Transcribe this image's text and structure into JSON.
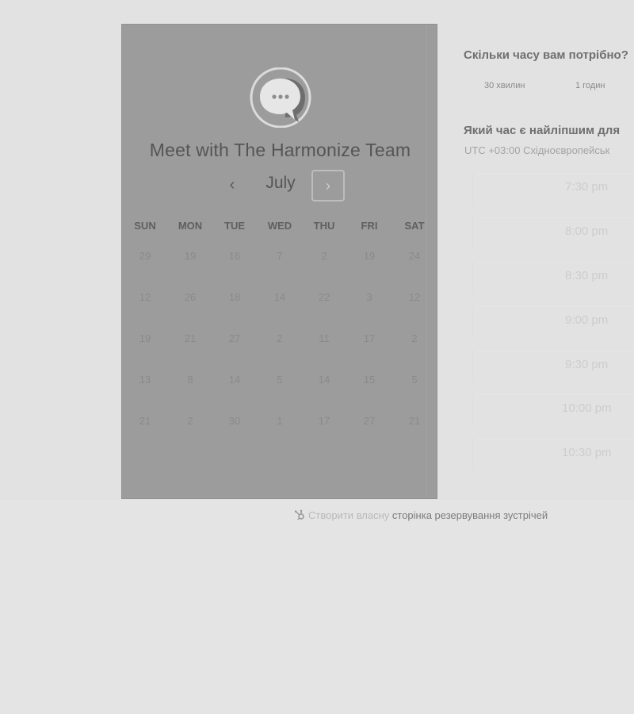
{
  "calendar": {
    "logo_icon": "chat-bubble-icon",
    "title": "Meet with The Harmonize Team",
    "month": "July",
    "prev_icon": "chevron-left-icon",
    "next_icon": "chevron-right-icon",
    "prev_glyph": "‹",
    "next_glyph": "›",
    "weekdays": [
      "SUN",
      "MON",
      "TUE",
      "WED",
      "THU",
      "FRI",
      "SAT"
    ],
    "weeks": [
      [
        "29",
        "19",
        "16",
        "7",
        "2",
        "19",
        "24"
      ],
      [
        "12",
        "26",
        "18",
        "14",
        "22",
        "3",
        "12"
      ],
      [
        "19",
        "21",
        "27",
        "2",
        "11",
        "17",
        "2"
      ],
      [
        "13",
        "8",
        "14",
        "5",
        "14",
        "15",
        "5"
      ],
      [
        "21",
        "2",
        "30",
        "1",
        "17",
        "27",
        "21"
      ]
    ]
  },
  "duration": {
    "question": "Скільки часу вам потрібно?",
    "options": [
      "30 хвилин",
      "1 годин"
    ]
  },
  "time": {
    "question": "Який час є найліпшим для",
    "timezone": "UTC +03:00 Східноєвропейськ",
    "slots": [
      "7:30 pm",
      "8:00 pm",
      "8:30 pm",
      "9:00 pm",
      "9:30 pm",
      "10:00 pm",
      "10:30 pm"
    ]
  },
  "footer": {
    "icon": "hubspot-sprocket-icon",
    "text": "Створити власну",
    "link": "сторінка резервування зустрічей"
  },
  "colors": {
    "page_bg": "#e4e4e4",
    "panel_bg": "#9c9c9c",
    "title_text": "#555555"
  }
}
